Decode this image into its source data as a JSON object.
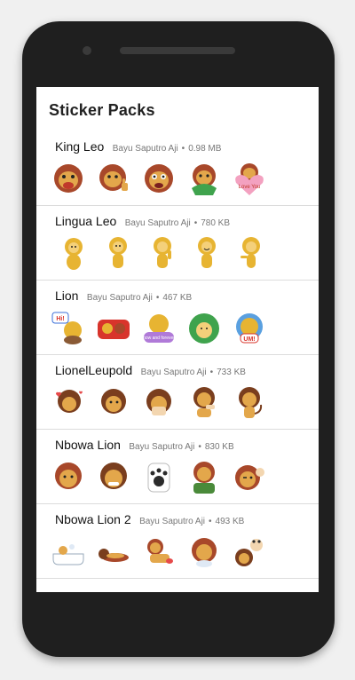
{
  "screen_title": "Sticker Packs",
  "packs": [
    {
      "name": "King Leo",
      "author": "Bayu Saputro Aji",
      "size": "0.98 MB",
      "stickers": [
        "laughing-lion",
        "thumbs-up-lion",
        "angry-lion",
        "leaf-lion",
        "love-you-lion"
      ],
      "speech": "Love You"
    },
    {
      "name": "Lingua Leo",
      "author": "Bayu Saputro Aji",
      "size": "780 KB",
      "stickers": [
        "sitting-lion",
        "standing-lion",
        "waving-lion",
        "smiling-lion",
        "walking-lion"
      ]
    },
    {
      "name": "Lion",
      "author": "Bayu Saputro Aji",
      "size": "467 KB",
      "stickers": [
        "hi-lion",
        "group-lion",
        "now-and-forever-lion",
        "snake-lion",
        "um-lion"
      ],
      "speech_hi": "Hi!",
      "speech_um": "UM!",
      "speech_now": "now and forever"
    },
    {
      "name": "LionelLeupold",
      "author": "Bayu Saputro Aji",
      "size": "733 KB",
      "stickers": [
        "hearts-lion",
        "thinking-lion",
        "crying-lion",
        "shrug-lion",
        "tail-lion"
      ]
    },
    {
      "name": "Nbowa Lion",
      "author": "Bayu Saputro Aji",
      "size": "830 KB",
      "stickers": [
        "serious-lion",
        "grin-lion",
        "paw-lion",
        "chest-lion",
        "wink-lion"
      ]
    },
    {
      "name": "Nbowa Lion 2",
      "author": "Bayu Saputro Aji",
      "size": "493 KB",
      "stickers": [
        "bath-lion",
        "lying-lion",
        "stretching-lion",
        "paw-lion-2",
        "dancing-lion"
      ]
    }
  ],
  "colors": {
    "mane": "#a8482a",
    "face": "#e3a74b",
    "gold": "#e7b432",
    "brown": "#8a5a35"
  }
}
